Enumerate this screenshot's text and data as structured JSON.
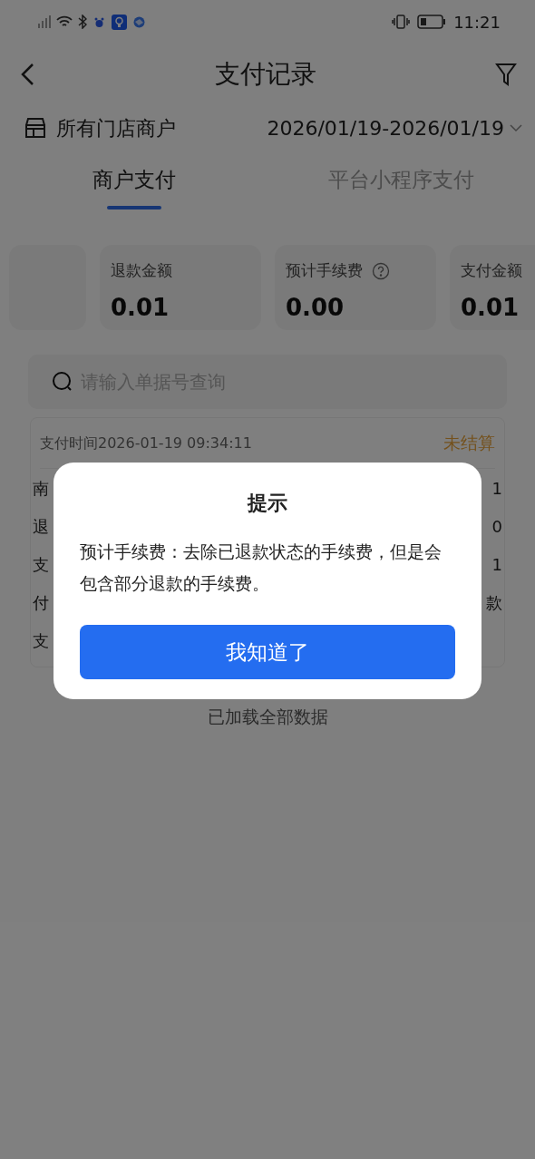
{
  "status_bar": {
    "time": "11:21"
  },
  "header": {
    "title": "支付记录"
  },
  "filter_bar": {
    "store": "所有门店商户",
    "date_range": "2026/01/19-2026/01/19"
  },
  "tabs": [
    {
      "label": "商户支付",
      "selected": true
    },
    {
      "label": "平台小程序支付",
      "selected": false
    }
  ],
  "stats": [
    {
      "label": "退款金额",
      "value": "0.01",
      "help": false
    },
    {
      "label": "预计手续费",
      "value": "0.00",
      "help": true
    },
    {
      "label": "支付金额",
      "value": "0.01",
      "help": false
    }
  ],
  "search": {
    "placeholder": "请输入单据号查询"
  },
  "record": {
    "time": "支付时间2026-01-19 09:34:11",
    "status": "未结算",
    "rows": [
      {
        "label": "南",
        "value": "1"
      },
      {
        "label": "退",
        "value": "0"
      },
      {
        "label": "支",
        "value": "1"
      },
      {
        "label": "付",
        "value": "款"
      },
      {
        "label": "支"
      }
    ]
  },
  "footer_note": "已加载全部数据",
  "dialog": {
    "title": "提示",
    "message": "预计手续费：去除已退款状态的手续费，但是会包含部分退款的手续费。",
    "button": "我知道了"
  }
}
